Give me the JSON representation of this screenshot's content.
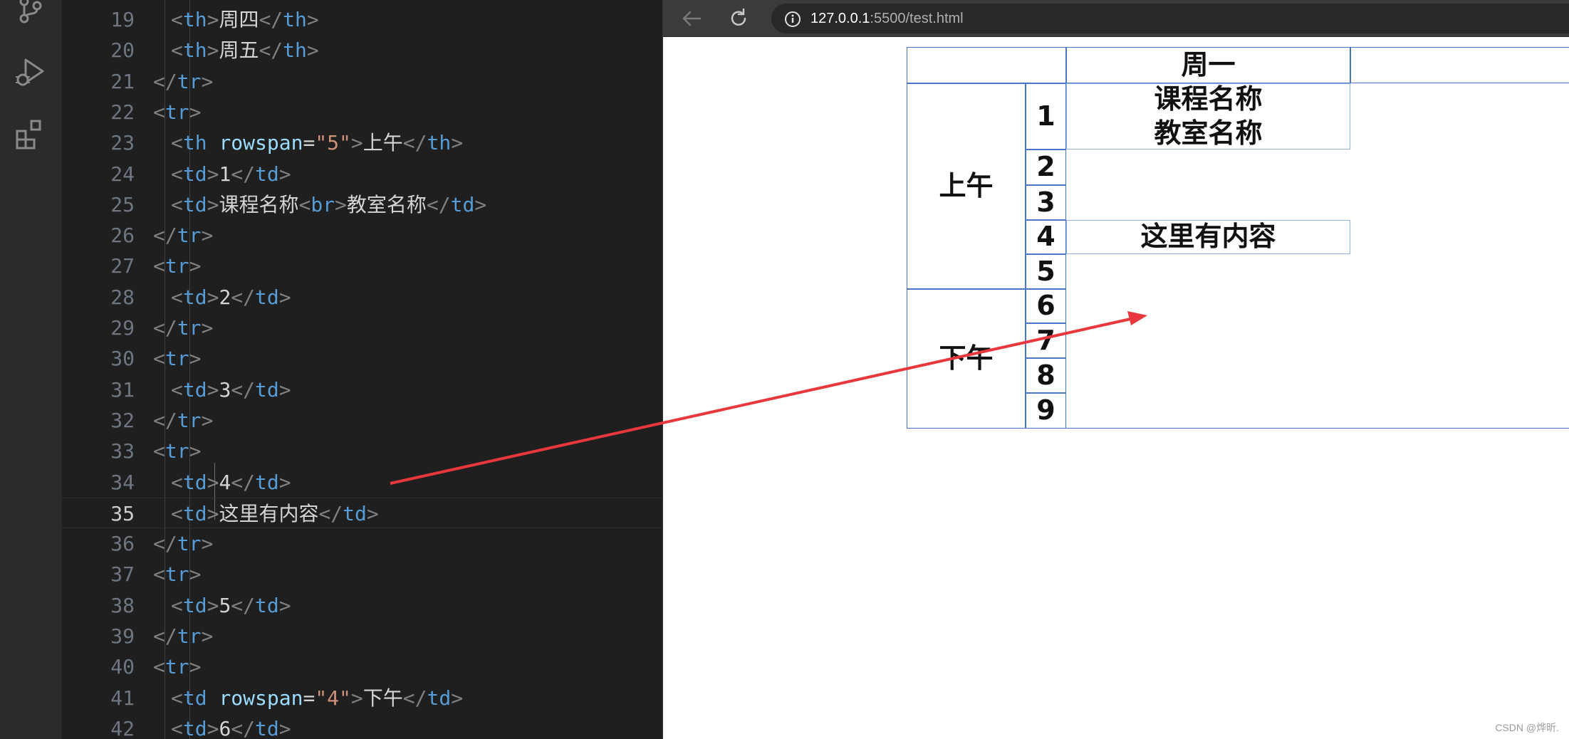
{
  "editor": {
    "lines": [
      {
        "num": "19",
        "tokens": [
          {
            "t": "<",
            "c": "br"
          },
          {
            "t": "th",
            "c": "tag"
          },
          {
            "t": ">",
            "c": "br"
          },
          {
            "t": "周四",
            "c": "txt"
          },
          {
            "t": "</",
            "c": "br"
          },
          {
            "t": "th",
            "c": "tag"
          },
          {
            "t": ">",
            "c": "br"
          }
        ]
      },
      {
        "num": "20",
        "tokens": [
          {
            "t": "<",
            "c": "br"
          },
          {
            "t": "th",
            "c": "tag"
          },
          {
            "t": ">",
            "c": "br"
          },
          {
            "t": "周五",
            "c": "txt"
          },
          {
            "t": "</",
            "c": "br"
          },
          {
            "t": "th",
            "c": "tag"
          },
          {
            "t": ">",
            "c": "br"
          }
        ]
      },
      {
        "num": "21",
        "tokens": [
          {
            "t": "</",
            "c": "br"
          },
          {
            "t": "tr",
            "c": "tag"
          },
          {
            "t": ">",
            "c": "br"
          }
        ]
      },
      {
        "num": "22",
        "tokens": [
          {
            "t": "<",
            "c": "br"
          },
          {
            "t": "tr",
            "c": "tag"
          },
          {
            "t": ">",
            "c": "br"
          }
        ]
      },
      {
        "num": "23",
        "tokens": [
          {
            "t": "<",
            "c": "br"
          },
          {
            "t": "th",
            "c": "tag"
          },
          {
            "t": " ",
            "c": "txt"
          },
          {
            "t": "rowspan",
            "c": "attr"
          },
          {
            "t": "=",
            "c": "txt"
          },
          {
            "t": "\"5\"",
            "c": "str"
          },
          {
            "t": ">",
            "c": "br"
          },
          {
            "t": "上午",
            "c": "txt"
          },
          {
            "t": "</",
            "c": "br"
          },
          {
            "t": "th",
            "c": "tag"
          },
          {
            "t": ">",
            "c": "br"
          }
        ]
      },
      {
        "num": "24",
        "tokens": [
          {
            "t": "<",
            "c": "br"
          },
          {
            "t": "td",
            "c": "tag"
          },
          {
            "t": ">",
            "c": "br"
          },
          {
            "t": "1",
            "c": "txt"
          },
          {
            "t": "</",
            "c": "br"
          },
          {
            "t": "td",
            "c": "tag"
          },
          {
            "t": ">",
            "c": "br"
          }
        ]
      },
      {
        "num": "25",
        "tokens": [
          {
            "t": "<",
            "c": "br"
          },
          {
            "t": "td",
            "c": "tag"
          },
          {
            "t": ">",
            "c": "br"
          },
          {
            "t": "课程名称",
            "c": "txt"
          },
          {
            "t": "<",
            "c": "br"
          },
          {
            "t": "br",
            "c": "tag"
          },
          {
            "t": ">",
            "c": "br"
          },
          {
            "t": "教室名称",
            "c": "txt"
          },
          {
            "t": "</",
            "c": "br"
          },
          {
            "t": "td",
            "c": "tag"
          },
          {
            "t": ">",
            "c": "br"
          }
        ]
      },
      {
        "num": "26",
        "tokens": [
          {
            "t": "</",
            "c": "br"
          },
          {
            "t": "tr",
            "c": "tag"
          },
          {
            "t": ">",
            "c": "br"
          }
        ]
      },
      {
        "num": "27",
        "tokens": [
          {
            "t": "<",
            "c": "br"
          },
          {
            "t": "tr",
            "c": "tag"
          },
          {
            "t": ">",
            "c": "br"
          }
        ]
      },
      {
        "num": "28",
        "tokens": [
          {
            "t": "<",
            "c": "br"
          },
          {
            "t": "td",
            "c": "tag"
          },
          {
            "t": ">",
            "c": "br"
          },
          {
            "t": "2",
            "c": "txt"
          },
          {
            "t": "</",
            "c": "br"
          },
          {
            "t": "td",
            "c": "tag"
          },
          {
            "t": ">",
            "c": "br"
          }
        ]
      },
      {
        "num": "29",
        "tokens": [
          {
            "t": "</",
            "c": "br"
          },
          {
            "t": "tr",
            "c": "tag"
          },
          {
            "t": ">",
            "c": "br"
          }
        ]
      },
      {
        "num": "30",
        "tokens": [
          {
            "t": "<",
            "c": "br"
          },
          {
            "t": "tr",
            "c": "tag"
          },
          {
            "t": ">",
            "c": "br"
          }
        ]
      },
      {
        "num": "31",
        "tokens": [
          {
            "t": "<",
            "c": "br"
          },
          {
            "t": "td",
            "c": "tag"
          },
          {
            "t": ">",
            "c": "br"
          },
          {
            "t": "3",
            "c": "txt"
          },
          {
            "t": "</",
            "c": "br"
          },
          {
            "t": "td",
            "c": "tag"
          },
          {
            "t": ">",
            "c": "br"
          }
        ]
      },
      {
        "num": "32",
        "tokens": [
          {
            "t": "</",
            "c": "br"
          },
          {
            "t": "tr",
            "c": "tag"
          },
          {
            "t": ">",
            "c": "br"
          }
        ]
      },
      {
        "num": "33",
        "tokens": [
          {
            "t": "<",
            "c": "br"
          },
          {
            "t": "tr",
            "c": "tag"
          },
          {
            "t": ">",
            "c": "br"
          }
        ]
      },
      {
        "num": "34",
        "tokens": [
          {
            "t": "<",
            "c": "br"
          },
          {
            "t": "td",
            "c": "tag"
          },
          {
            "t": ">",
            "c": "br"
          },
          {
            "t": "4",
            "c": "txt"
          },
          {
            "t": "</",
            "c": "br"
          },
          {
            "t": "td",
            "c": "tag"
          },
          {
            "t": ">",
            "c": "br"
          }
        ]
      },
      {
        "num": "35",
        "current": true,
        "tokens": [
          {
            "t": "<",
            "c": "br"
          },
          {
            "t": "td",
            "c": "tag"
          },
          {
            "t": ">",
            "c": "br"
          },
          {
            "t": "这里有内容",
            "c": "txt"
          },
          {
            "t": "</",
            "c": "br"
          },
          {
            "t": "td",
            "c": "tag"
          },
          {
            "t": ">",
            "c": "br"
          }
        ]
      },
      {
        "num": "36",
        "tokens": [
          {
            "t": "</",
            "c": "br"
          },
          {
            "t": "tr",
            "c": "tag"
          },
          {
            "t": ">",
            "c": "br"
          }
        ]
      },
      {
        "num": "37",
        "tokens": [
          {
            "t": "<",
            "c": "br"
          },
          {
            "t": "tr",
            "c": "tag"
          },
          {
            "t": ">",
            "c": "br"
          }
        ]
      },
      {
        "num": "38",
        "tokens": [
          {
            "t": "<",
            "c": "br"
          },
          {
            "t": "td",
            "c": "tag"
          },
          {
            "t": ">",
            "c": "br"
          },
          {
            "t": "5",
            "c": "txt"
          },
          {
            "t": "</",
            "c": "br"
          },
          {
            "t": "td",
            "c": "tag"
          },
          {
            "t": ">",
            "c": "br"
          }
        ]
      },
      {
        "num": "39",
        "tokens": [
          {
            "t": "</",
            "c": "br"
          },
          {
            "t": "tr",
            "c": "tag"
          },
          {
            "t": ">",
            "c": "br"
          }
        ]
      },
      {
        "num": "40",
        "tokens": [
          {
            "t": "<",
            "c": "br"
          },
          {
            "t": "tr",
            "c": "tag"
          },
          {
            "t": ">",
            "c": "br"
          }
        ]
      },
      {
        "num": "41",
        "tokens": [
          {
            "t": "<",
            "c": "br"
          },
          {
            "t": "td",
            "c": "tag"
          },
          {
            "t": " ",
            "c": "txt"
          },
          {
            "t": "rowspan",
            "c": "attr"
          },
          {
            "t": "=",
            "c": "txt"
          },
          {
            "t": "\"4\"",
            "c": "str"
          },
          {
            "t": ">",
            "c": "br"
          },
          {
            "t": "下午",
            "c": "txt"
          },
          {
            "t": "</",
            "c": "br"
          },
          {
            "t": "td",
            "c": "tag"
          },
          {
            "t": ">",
            "c": "br"
          }
        ]
      },
      {
        "num": "42",
        "tokens": [
          {
            "t": "<",
            "c": "br"
          },
          {
            "t": "td",
            "c": "tag"
          },
          {
            "t": ">",
            "c": "br"
          },
          {
            "t": "6",
            "c": "txt"
          },
          {
            "t": "</",
            "c": "br"
          },
          {
            "t": "td",
            "c": "tag"
          },
          {
            "t": ">",
            "c": "br"
          }
        ]
      }
    ]
  },
  "browser": {
    "url_host": "127.0.0.1",
    "url_rest": ":5500/test.html"
  },
  "table": {
    "header_day": "周一",
    "morning": "上午",
    "afternoon": "下午",
    "periods": [
      "1",
      "2",
      "3",
      "4",
      "5",
      "6",
      "7",
      "8",
      "9"
    ],
    "course_line1": "课程名称",
    "course_line2": "教室名称",
    "content_cell": "这里有内容"
  },
  "watermark": "CSDN @烨昕.",
  "colors": {
    "cell_border": "#4a76c8",
    "arrow": "#e8383d",
    "editor_bg": "#1f1f1f"
  }
}
